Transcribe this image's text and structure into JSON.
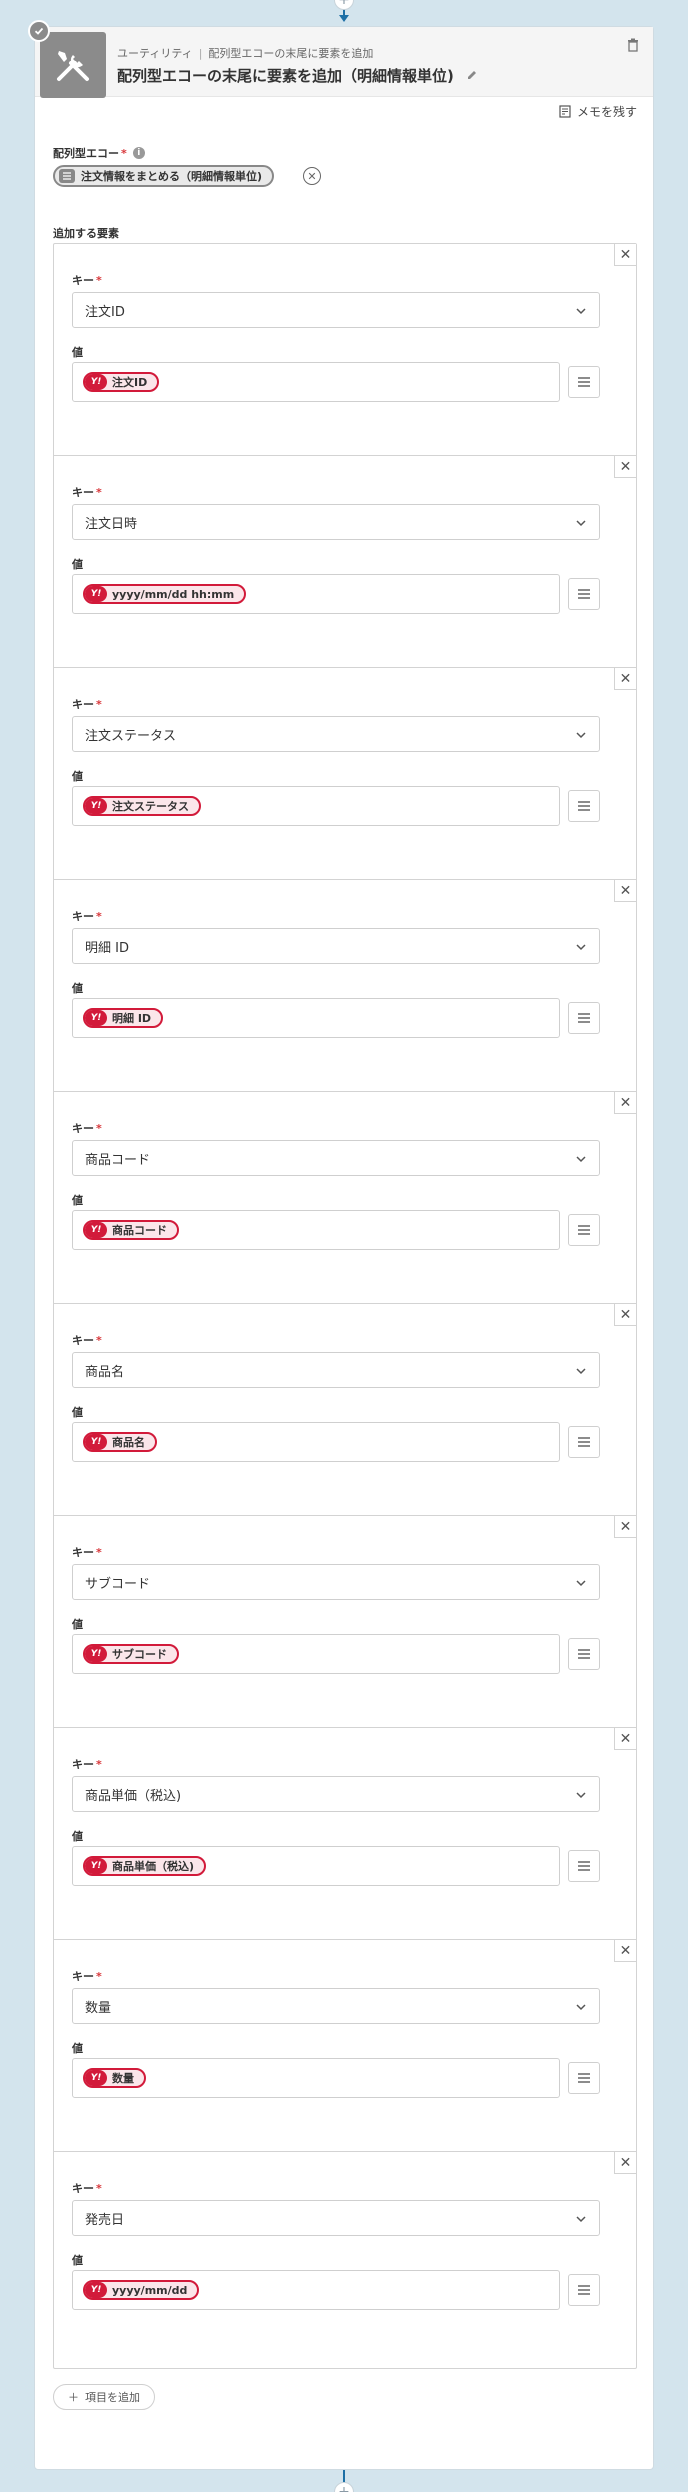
{
  "header": {
    "breadcrumb_category": "ユーティリティ",
    "breadcrumb_separator": "|",
    "breadcrumb_action": "配列型エコーの末尾に要素を追加",
    "title": "配列型エコーの末尾に要素を追加（明細情報単位)",
    "memo_label": "メモを残す"
  },
  "array_field": {
    "label": "配列型エコー",
    "required_mark": "*",
    "selected": "注文情報をまとめる（明細情報単位)"
  },
  "elements_section": {
    "label": "追加する要素",
    "key_label": "キー",
    "value_label": "値",
    "required_mark": "*",
    "items": [
      {
        "key": "注文ID",
        "value": "注文ID"
      },
      {
        "key": "注文日時",
        "value": "yyyy/mm/dd hh:mm"
      },
      {
        "key": "注文ステータス",
        "value": "注文ステータス"
      },
      {
        "key": "明細 ID",
        "value": "明細 ID"
      },
      {
        "key": "商品コード",
        "value": "商品コード"
      },
      {
        "key": "商品名",
        "value": "商品名"
      },
      {
        "key": "サブコード",
        "value": "サブコード"
      },
      {
        "key": "商品単価（税込)",
        "value": "商品単価（税込)"
      },
      {
        "key": "数量",
        "value": "数量"
      },
      {
        "key": "発売日",
        "value": "yyyy/mm/dd"
      }
    ]
  },
  "add_item_label": "項目を追加",
  "colors": {
    "accent_blue": "#1d6fa5",
    "variable_red": "#d21a3a",
    "background": "#d3e4ed"
  }
}
